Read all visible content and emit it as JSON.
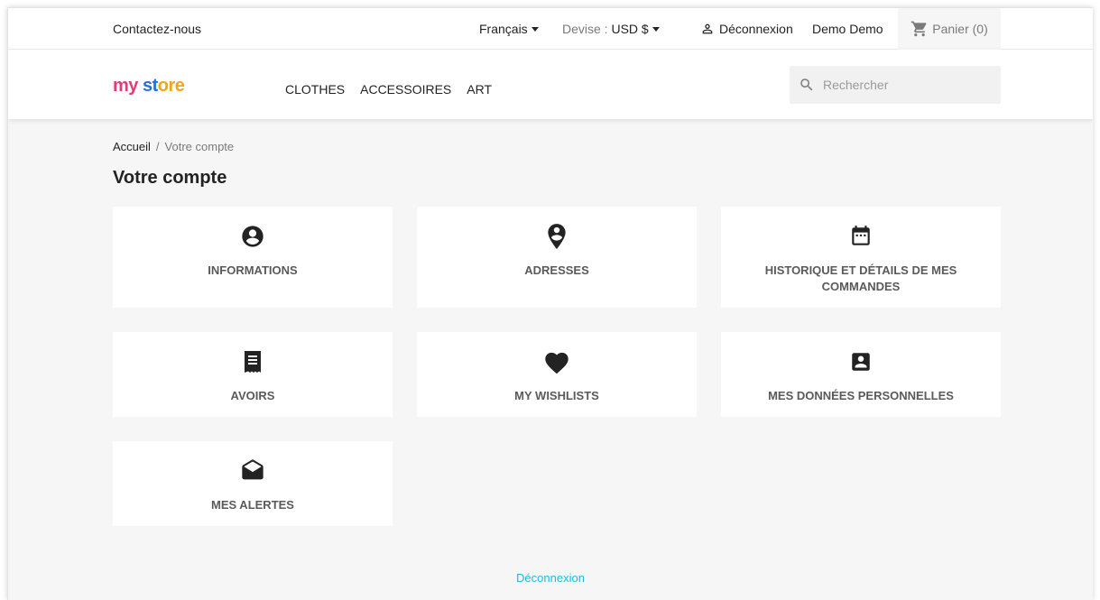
{
  "topbar": {
    "contact": "Contactez-nous",
    "language": "Français",
    "currency_label": "Devise :",
    "currency_value": "USD $",
    "logout": "Déconnexion",
    "user": "Demo Demo",
    "cart": "Panier (0)"
  },
  "header": {
    "logo": [
      "my",
      " ",
      "st",
      "ore"
    ],
    "menu": [
      "Clothes",
      "Accessoires",
      "Art"
    ],
    "search_placeholder": "Rechercher"
  },
  "breadcrumb": {
    "home": "Accueil",
    "separator": "/",
    "current": "Votre compte"
  },
  "page_title": "Votre compte",
  "tiles": [
    {
      "label": "Informations",
      "icon": "account-circle-icon"
    },
    {
      "label": "Adresses",
      "icon": "location-pin-icon"
    },
    {
      "label": "Historique et détails de mes commandes",
      "icon": "calendar-icon"
    },
    {
      "label": "Avoirs",
      "icon": "receipt-icon"
    },
    {
      "label": "My wishlists",
      "icon": "heart-icon"
    },
    {
      "label": "Mes données personnelles",
      "icon": "account-box-icon"
    },
    {
      "label": "Mes alertes",
      "icon": "envelope-open-icon"
    }
  ],
  "footer": {
    "logout": "Déconnexion"
  },
  "colors": {
    "link": "#24b9d7",
    "background": "#f6f6f6",
    "tile": "#ffffff"
  }
}
